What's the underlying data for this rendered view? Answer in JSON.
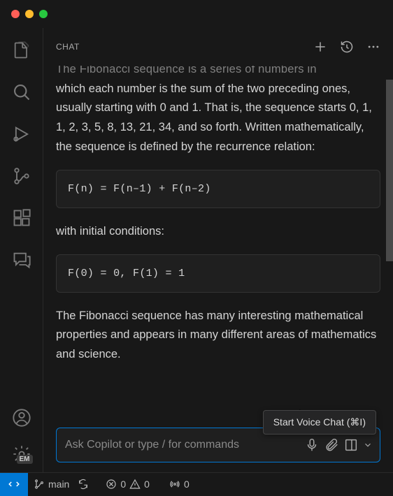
{
  "chat": {
    "title": "CHAT",
    "cutoff_line": "The Fibonacci sequence is a series of numbers in",
    "para1": "which each number is the sum of the two preceding ones, usually starting with 0 and 1. That is, the sequence starts 0, 1, 1, 2, 3, 5, 8, 13, 21, 34, and so forth. Written mathematically, the sequence is defined by the recurrence relation:",
    "code1": "F(n) = F(n–1) + F(n–2)",
    "para2": "with initial conditions:",
    "code2": "F(0) = 0, F(1) = 1",
    "para3": "The Fibonacci sequence has many interesting mathematical properties and appears in many different areas of mathematics and science."
  },
  "input": {
    "placeholder": "Ask Copilot or type / for commands"
  },
  "tooltip": {
    "text": "Start Voice Chat (⌘I)"
  },
  "status": {
    "branch": "main",
    "errors": "0",
    "warnings": "0",
    "ports": "0"
  },
  "badge": {
    "em": "EM"
  }
}
